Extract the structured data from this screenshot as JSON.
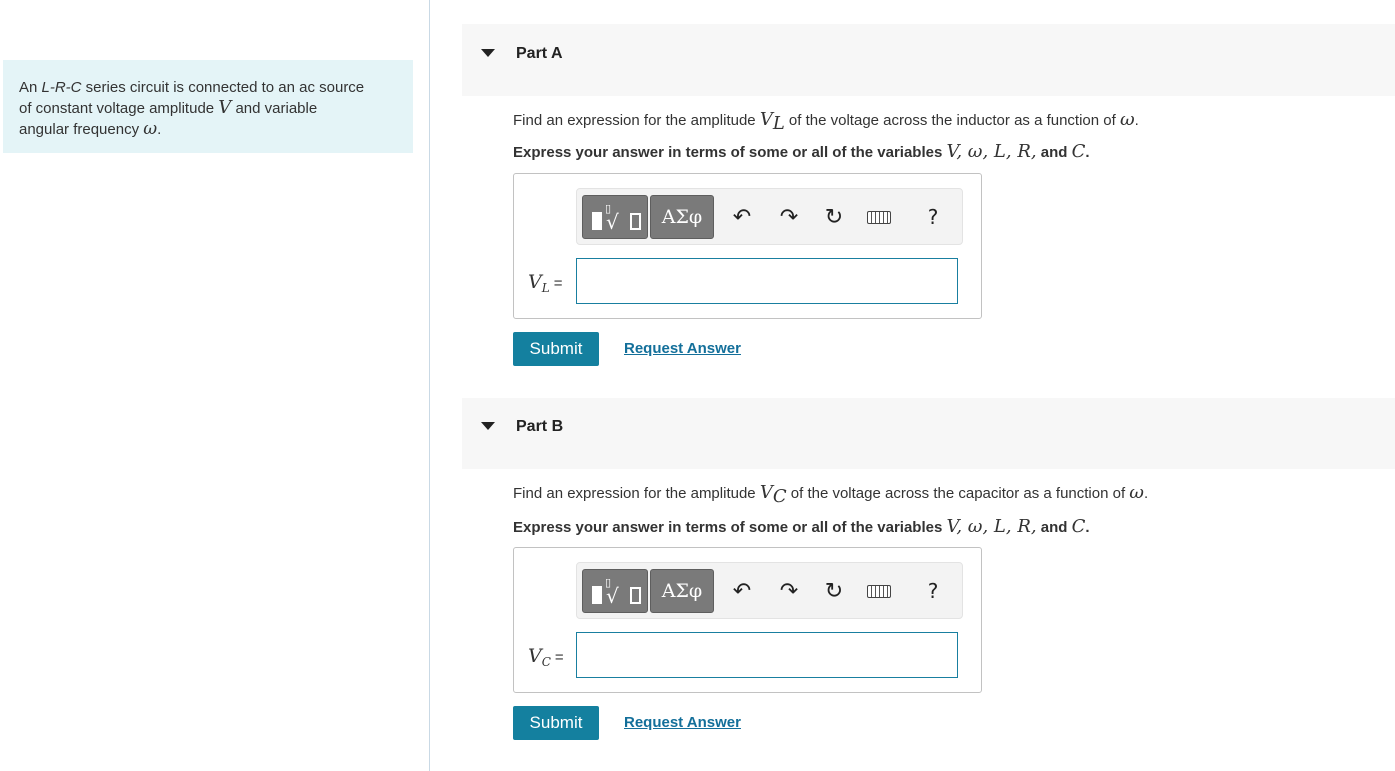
{
  "intro": {
    "line1_pre": "An ",
    "line1_em": "L-R-C",
    "line1_post": " series circuit is connected to an ac source",
    "line2_pre": "of constant voltage amplitude ",
    "line2_var": "V",
    "line2_post": " and variable",
    "line3_pre": "angular frequency ",
    "line3_var": "ω",
    "line3_post": "."
  },
  "toolbar": {
    "greek_label": "ΑΣφ",
    "help_label": "?",
    "undo_glyph": "↶",
    "redo_glyph": "↷",
    "reset_glyph": "↻",
    "icons": [
      "templates-icon",
      "greek-letters-icon",
      "undo-icon",
      "redo-icon",
      "reset-icon",
      "keyboard-icon",
      "help-icon"
    ]
  },
  "partA": {
    "title": "Part A",
    "prompt_pre": "Find an expression for the amplitude ",
    "prompt_var": "V",
    "prompt_sub": "L",
    "prompt_post": " of the voltage across the inductor as a function of ",
    "prompt_w": "ω",
    "prompt_end": ".",
    "express_pre": "Express your answer in terms of some or all of the variables ",
    "express_vars": "V, ω, L, R,",
    "express_and": " and ",
    "express_last": "C",
    "express_end": ".",
    "var_label": "V",
    "var_sub": "L",
    "eq": "=",
    "input_value": "",
    "submit_label": "Submit",
    "request_label": "Request Answer"
  },
  "partB": {
    "title": "Part B",
    "prompt_pre": "Find an expression for the amplitude ",
    "prompt_var": "V",
    "prompt_sub": "C",
    "prompt_post": " of the voltage across the capacitor as a function of ",
    "prompt_w": "ω",
    "prompt_end": ".",
    "express_pre": "Express your answer in terms of some or all of the variables ",
    "express_vars": "V, ω, L, R,",
    "express_and": " and ",
    "express_last": "C",
    "express_end": ".",
    "var_label": "V",
    "var_sub": "C",
    "eq": "=",
    "input_value": "",
    "submit_label": "Submit",
    "request_label": "Request Answer"
  },
  "colors": {
    "accent": "#14809f",
    "link": "#136f9a",
    "intro_bg": "#e4f4f7",
    "header_bg": "#f7f7f7"
  }
}
